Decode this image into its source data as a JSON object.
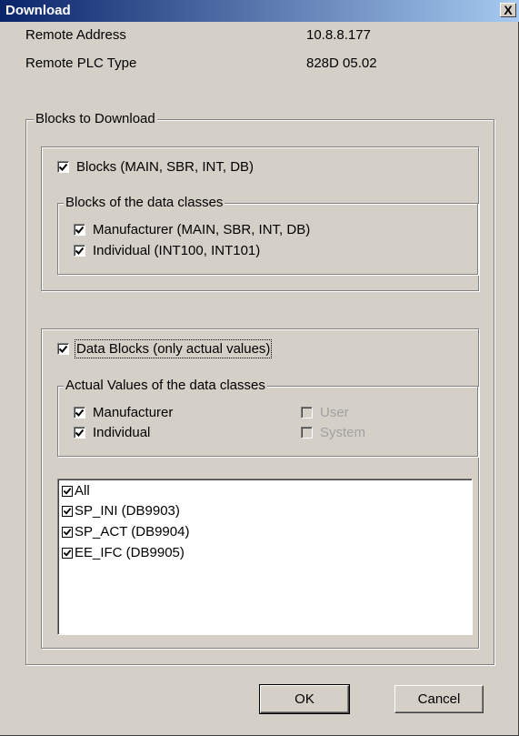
{
  "window": {
    "title": "Download",
    "close_label": "X"
  },
  "info": {
    "remote_address_label": "Remote Address",
    "remote_address_value": "10.8.8.177",
    "plc_type_label": "Remote PLC Type",
    "plc_type_value": "828D 05.02"
  },
  "blocks_group": {
    "legend": "Blocks to Download",
    "blocks_checkbox": {
      "label": "Blocks (MAIN, SBR, INT, DB)",
      "checked": true
    },
    "data_classes": {
      "legend": "Blocks of the data classes",
      "manufacturer": {
        "label": "Manufacturer (MAIN, SBR, INT, DB)",
        "checked": true
      },
      "individual": {
        "label": "Individual (INT100, INT101)",
        "checked": true
      }
    },
    "data_blocks_checkbox": {
      "label": "Data Blocks (only actual values)",
      "checked": true
    },
    "actual_values": {
      "legend": "Actual Values of the data classes",
      "manufacturer": {
        "label": "Manufacturer",
        "checked": true
      },
      "individual": {
        "label": "Individual",
        "checked": true
      },
      "user": {
        "label": "User",
        "checked": false,
        "disabled": true
      },
      "system": {
        "label": "System",
        "checked": false,
        "disabled": true
      }
    },
    "list": [
      {
        "label": "All",
        "checked": true
      },
      {
        "label": "SP_INI (DB9903)",
        "checked": true
      },
      {
        "label": "SP_ACT (DB9904)",
        "checked": true
      },
      {
        "label": "EE_IFC (DB9905)",
        "checked": true
      }
    ]
  },
  "buttons": {
    "ok_label": "OK",
    "cancel_label": "Cancel"
  }
}
